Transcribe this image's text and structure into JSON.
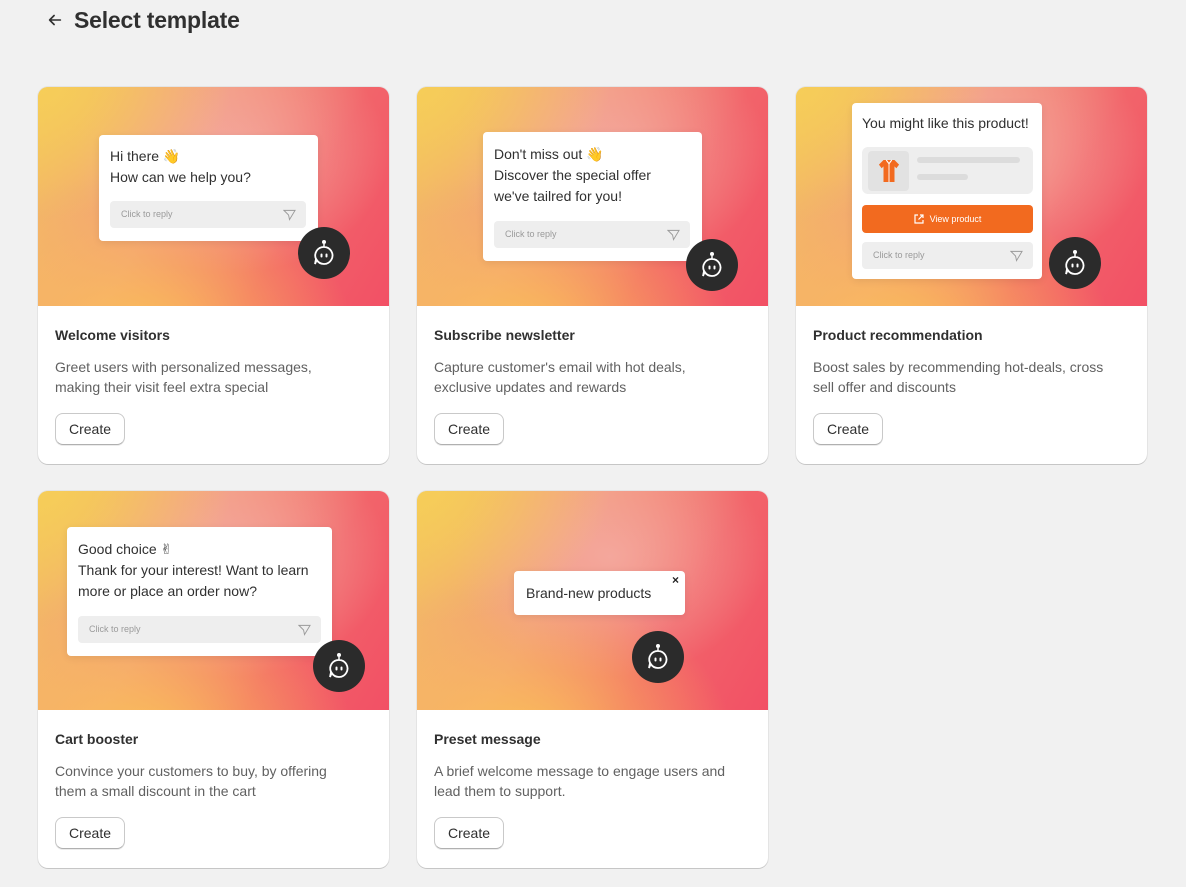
{
  "header": {
    "title": "Select template",
    "back_icon": "arrow-left-icon"
  },
  "brand": {
    "orange": "#f26a1f",
    "bot_bg": "#2b2b2b"
  },
  "cards": [
    {
      "title": "Welcome visitors",
      "description": "Greet users with personalized messages, making their visit feel extra special",
      "button": "Create",
      "preview": {
        "message": "Hi there 👋\nHow can we help you?",
        "reply_placeholder": "Click to reply"
      }
    },
    {
      "title": "Subscribe newsletter",
      "description": "Capture customer's email with hot deals, exclusive updates and rewards",
      "button": "Create",
      "preview": {
        "message": "Don't miss out 👋\nDiscover the special offer\nwe've tailred for you!",
        "reply_placeholder": "Click to reply"
      }
    },
    {
      "title": "Product recommendation",
      "description": "Boost sales by recommending hot-deals, cross sell offer and discounts",
      "button": "Create",
      "preview": {
        "message": "You might like this product!",
        "cta": "View product",
        "reply_placeholder": "Click to reply"
      }
    },
    {
      "title": "Cart booster",
      "description": "Convince your customers to buy, by offering them a small discount in the cart",
      "button": "Create",
      "preview": {
        "message": "Good choice ✌\nThank for your interest! Want to learn\nmore or place an order now?",
        "reply_placeholder": "Click to reply"
      }
    },
    {
      "title": "Preset message",
      "description": "A brief welcome message to engage users and lead them to support.",
      "button": "Create",
      "preview": {
        "message": "Brand-new products",
        "close": "×"
      }
    }
  ]
}
